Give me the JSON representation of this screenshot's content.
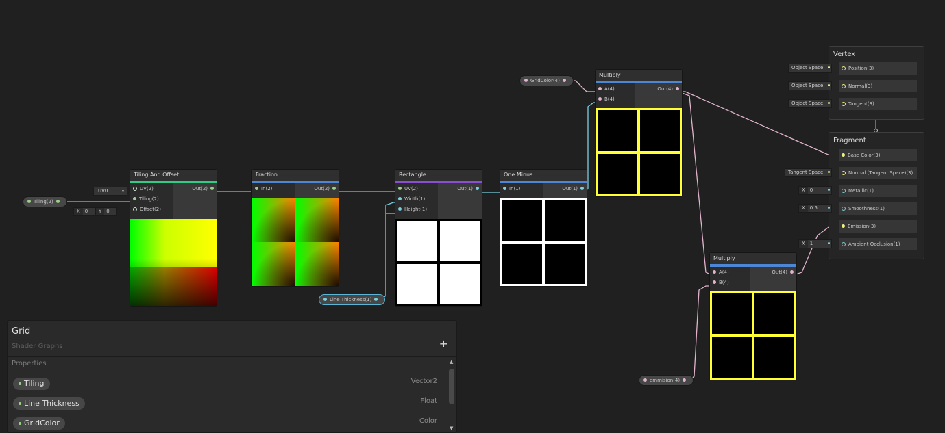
{
  "colors": {
    "background": "#202020",
    "tiling_bar": "#2fcc84",
    "fraction_bar": "#4d86d4",
    "rectangle_bar": "#8a4fd0",
    "one_minus_bar": "#4d86d4",
    "multiply_bar": "#4d86d4",
    "yellow_grid": "#ffff33",
    "wire_green": "#7fd07a",
    "wire_cyan": "#7ad0e0",
    "wire_pink": "#e0b4cc"
  },
  "nodes": {
    "tiling_offset": {
      "title": "Tiling And Offset",
      "inputs": [
        "UV(2)",
        "Tiling(2)",
        "Offset(2)"
      ],
      "output": "Out(2)",
      "uv_select": "UV0",
      "offset_x_label": "X",
      "offset_x_value": "0",
      "offset_y_label": "Y",
      "offset_y_value": "0"
    },
    "fraction": {
      "title": "Fraction",
      "input": "In(2)",
      "output": "Out(2)"
    },
    "rectangle": {
      "title": "Rectangle",
      "inputs": [
        "UV(2)",
        "Width(1)",
        "Height(1)"
      ],
      "output": "Out(1)"
    },
    "one_minus": {
      "title": "One Minus",
      "input": "In(1)",
      "output": "Out(1)"
    },
    "multiply_top": {
      "title": "Multiply",
      "inputs": [
        "A(4)",
        "B(4)"
      ],
      "output": "Out(4)"
    },
    "multiply_bottom": {
      "title": "Multiply",
      "inputs": [
        "A(4)",
        "B(4)"
      ],
      "output": "Out(4)"
    }
  },
  "property_nodes": {
    "tiling": "Tiling(2)",
    "line_thickness": "Line Thickness(1)",
    "grid_color": "GridColor(4)",
    "emission": "emmision(4)"
  },
  "vertex": {
    "title": "Vertex",
    "slots": [
      {
        "label": "Position(3)",
        "field": "Object Space"
      },
      {
        "label": "Normal(3)",
        "field": "Object Space"
      },
      {
        "label": "Tangent(3)",
        "field": "Object Space"
      }
    ]
  },
  "fragment": {
    "title": "Fragment",
    "slots": [
      {
        "label": "Base Color(3)",
        "field": ""
      },
      {
        "label": "Normal (Tangent Space)(3)",
        "field": "Tangent Space"
      },
      {
        "label": "Metallic(1)",
        "field": "0",
        "axis": "X"
      },
      {
        "label": "Smoothness(1)",
        "field": "0.5",
        "axis": "X"
      },
      {
        "label": "Emission(3)",
        "field": ""
      },
      {
        "label": "Ambient Occlusion(1)",
        "field": "1",
        "axis": "X"
      }
    ]
  },
  "blackboard": {
    "title": "Grid",
    "subtitle": "Shader Graphs",
    "add_label": "+",
    "section": "Properties",
    "properties": [
      {
        "name": "Tiling",
        "type": "Vector2"
      },
      {
        "name": "Line Thickness",
        "type": "Float"
      },
      {
        "name": "GridColor",
        "type": "Color"
      }
    ]
  }
}
